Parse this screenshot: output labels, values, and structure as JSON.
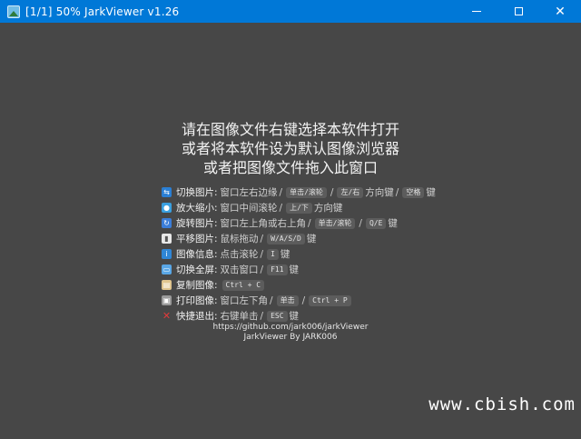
{
  "window": {
    "title": "[1/1] 50% JarkViewer v1.26",
    "icon": "image-viewer-icon",
    "controls": {
      "minimize": "minimize-icon",
      "maximize": "maximize-icon",
      "close": "close-icon"
    }
  },
  "hero": {
    "line1": "请在图像文件右键选择本软件打开",
    "line2": "或者将本软件设为默认图像浏览器",
    "line3": "或者把图像文件拖入此窗口"
  },
  "shortcuts": [
    {
      "icon": "switch-image-icon",
      "color": "#2a7fd4",
      "label": "切换图片",
      "desc": "窗口左右边缘",
      "keys": [
        "单击/滚轮",
        "左/右"
      ],
      "after": "方向键",
      "keys2": [
        "空格"
      ],
      "tail": "键"
    },
    {
      "icon": "zoom-icon",
      "color": "#3aa0e0",
      "label": "放大缩小",
      "desc": "窗口中间滚轮",
      "keys": [
        "上/下"
      ],
      "after": "方向键"
    },
    {
      "icon": "rotate-icon",
      "color": "#3b7dd8",
      "label": "旋转图片",
      "desc": "窗口左上角或右上角",
      "keys": [
        "单击/滚轮",
        "Q/E"
      ],
      "after": "键"
    },
    {
      "icon": "pan-icon",
      "color": "#e8e8e8",
      "label": "平移图片",
      "desc": "鼠标拖动",
      "keys": [
        "W/A/S/D"
      ],
      "after": "键"
    },
    {
      "icon": "info-icon",
      "color": "#2f86d6",
      "label": "图像信息",
      "desc": "点击滚轮",
      "keys": [
        "I"
      ],
      "after": "键"
    },
    {
      "icon": "fullscreen-icon",
      "color": "#5aa7e6",
      "label": "切换全屏",
      "desc": "双击窗口",
      "keys": [
        "F11"
      ],
      "after": "键"
    },
    {
      "icon": "copy-icon",
      "color": "#e0c58f",
      "label": "复制图像",
      "desc": "",
      "keys": [
        "Ctrl + C"
      ],
      "after": ""
    },
    {
      "icon": "print-icon",
      "color": "#9a9a9a",
      "label": "打印图像",
      "desc": "窗口左下角",
      "keys": [
        "单击",
        "Ctrl + P"
      ],
      "after": ""
    },
    {
      "icon": "exit-icon",
      "color": "#e23b3b",
      "label": "快捷退出",
      "desc": "右键单击",
      "keys": [
        "ESC"
      ],
      "after": "键"
    }
  ],
  "footer": {
    "url": "https://github.com/jark006/jarkViewer",
    "credit": "JarkViewer By JARK006"
  },
  "watermark": "www.cbish.com"
}
